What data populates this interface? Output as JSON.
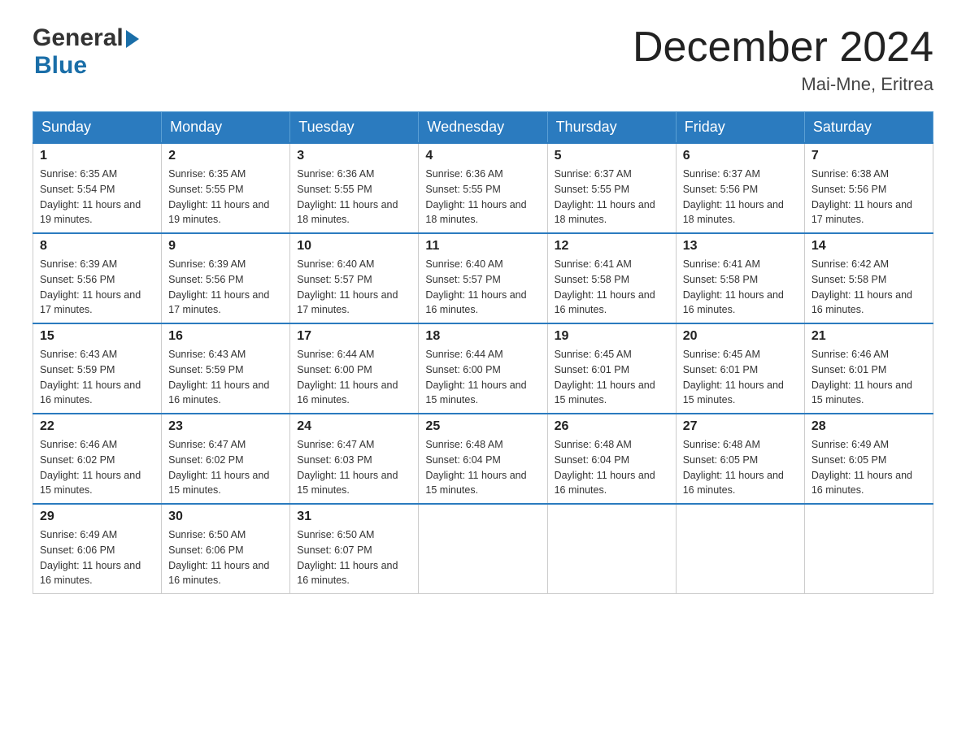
{
  "header": {
    "logo_general": "General",
    "logo_blue": "Blue",
    "main_title": "December 2024",
    "subtitle": "Mai-Mne, Eritrea"
  },
  "calendar": {
    "days_of_week": [
      "Sunday",
      "Monday",
      "Tuesday",
      "Wednesday",
      "Thursday",
      "Friday",
      "Saturday"
    ],
    "weeks": [
      [
        {
          "day": "1",
          "sunrise": "6:35 AM",
          "sunset": "5:54 PM",
          "daylight": "11 hours and 19 minutes."
        },
        {
          "day": "2",
          "sunrise": "6:35 AM",
          "sunset": "5:55 PM",
          "daylight": "11 hours and 19 minutes."
        },
        {
          "day": "3",
          "sunrise": "6:36 AM",
          "sunset": "5:55 PM",
          "daylight": "11 hours and 18 minutes."
        },
        {
          "day": "4",
          "sunrise": "6:36 AM",
          "sunset": "5:55 PM",
          "daylight": "11 hours and 18 minutes."
        },
        {
          "day": "5",
          "sunrise": "6:37 AM",
          "sunset": "5:55 PM",
          "daylight": "11 hours and 18 minutes."
        },
        {
          "day": "6",
          "sunrise": "6:37 AM",
          "sunset": "5:56 PM",
          "daylight": "11 hours and 18 minutes."
        },
        {
          "day": "7",
          "sunrise": "6:38 AM",
          "sunset": "5:56 PM",
          "daylight": "11 hours and 17 minutes."
        }
      ],
      [
        {
          "day": "8",
          "sunrise": "6:39 AM",
          "sunset": "5:56 PM",
          "daylight": "11 hours and 17 minutes."
        },
        {
          "day": "9",
          "sunrise": "6:39 AM",
          "sunset": "5:56 PM",
          "daylight": "11 hours and 17 minutes."
        },
        {
          "day": "10",
          "sunrise": "6:40 AM",
          "sunset": "5:57 PM",
          "daylight": "11 hours and 17 minutes."
        },
        {
          "day": "11",
          "sunrise": "6:40 AM",
          "sunset": "5:57 PM",
          "daylight": "11 hours and 16 minutes."
        },
        {
          "day": "12",
          "sunrise": "6:41 AM",
          "sunset": "5:58 PM",
          "daylight": "11 hours and 16 minutes."
        },
        {
          "day": "13",
          "sunrise": "6:41 AM",
          "sunset": "5:58 PM",
          "daylight": "11 hours and 16 minutes."
        },
        {
          "day": "14",
          "sunrise": "6:42 AM",
          "sunset": "5:58 PM",
          "daylight": "11 hours and 16 minutes."
        }
      ],
      [
        {
          "day": "15",
          "sunrise": "6:43 AM",
          "sunset": "5:59 PM",
          "daylight": "11 hours and 16 minutes."
        },
        {
          "day": "16",
          "sunrise": "6:43 AM",
          "sunset": "5:59 PM",
          "daylight": "11 hours and 16 minutes."
        },
        {
          "day": "17",
          "sunrise": "6:44 AM",
          "sunset": "6:00 PM",
          "daylight": "11 hours and 16 minutes."
        },
        {
          "day": "18",
          "sunrise": "6:44 AM",
          "sunset": "6:00 PM",
          "daylight": "11 hours and 15 minutes."
        },
        {
          "day": "19",
          "sunrise": "6:45 AM",
          "sunset": "6:01 PM",
          "daylight": "11 hours and 15 minutes."
        },
        {
          "day": "20",
          "sunrise": "6:45 AM",
          "sunset": "6:01 PM",
          "daylight": "11 hours and 15 minutes."
        },
        {
          "day": "21",
          "sunrise": "6:46 AM",
          "sunset": "6:01 PM",
          "daylight": "11 hours and 15 minutes."
        }
      ],
      [
        {
          "day": "22",
          "sunrise": "6:46 AM",
          "sunset": "6:02 PM",
          "daylight": "11 hours and 15 minutes."
        },
        {
          "day": "23",
          "sunrise": "6:47 AM",
          "sunset": "6:02 PM",
          "daylight": "11 hours and 15 minutes."
        },
        {
          "day": "24",
          "sunrise": "6:47 AM",
          "sunset": "6:03 PM",
          "daylight": "11 hours and 15 minutes."
        },
        {
          "day": "25",
          "sunrise": "6:48 AM",
          "sunset": "6:04 PM",
          "daylight": "11 hours and 15 minutes."
        },
        {
          "day": "26",
          "sunrise": "6:48 AM",
          "sunset": "6:04 PM",
          "daylight": "11 hours and 16 minutes."
        },
        {
          "day": "27",
          "sunrise": "6:48 AM",
          "sunset": "6:05 PM",
          "daylight": "11 hours and 16 minutes."
        },
        {
          "day": "28",
          "sunrise": "6:49 AM",
          "sunset": "6:05 PM",
          "daylight": "11 hours and 16 minutes."
        }
      ],
      [
        {
          "day": "29",
          "sunrise": "6:49 AM",
          "sunset": "6:06 PM",
          "daylight": "11 hours and 16 minutes."
        },
        {
          "day": "30",
          "sunrise": "6:50 AM",
          "sunset": "6:06 PM",
          "daylight": "11 hours and 16 minutes."
        },
        {
          "day": "31",
          "sunrise": "6:50 AM",
          "sunset": "6:07 PM",
          "daylight": "11 hours and 16 minutes."
        },
        null,
        null,
        null,
        null
      ]
    ]
  }
}
